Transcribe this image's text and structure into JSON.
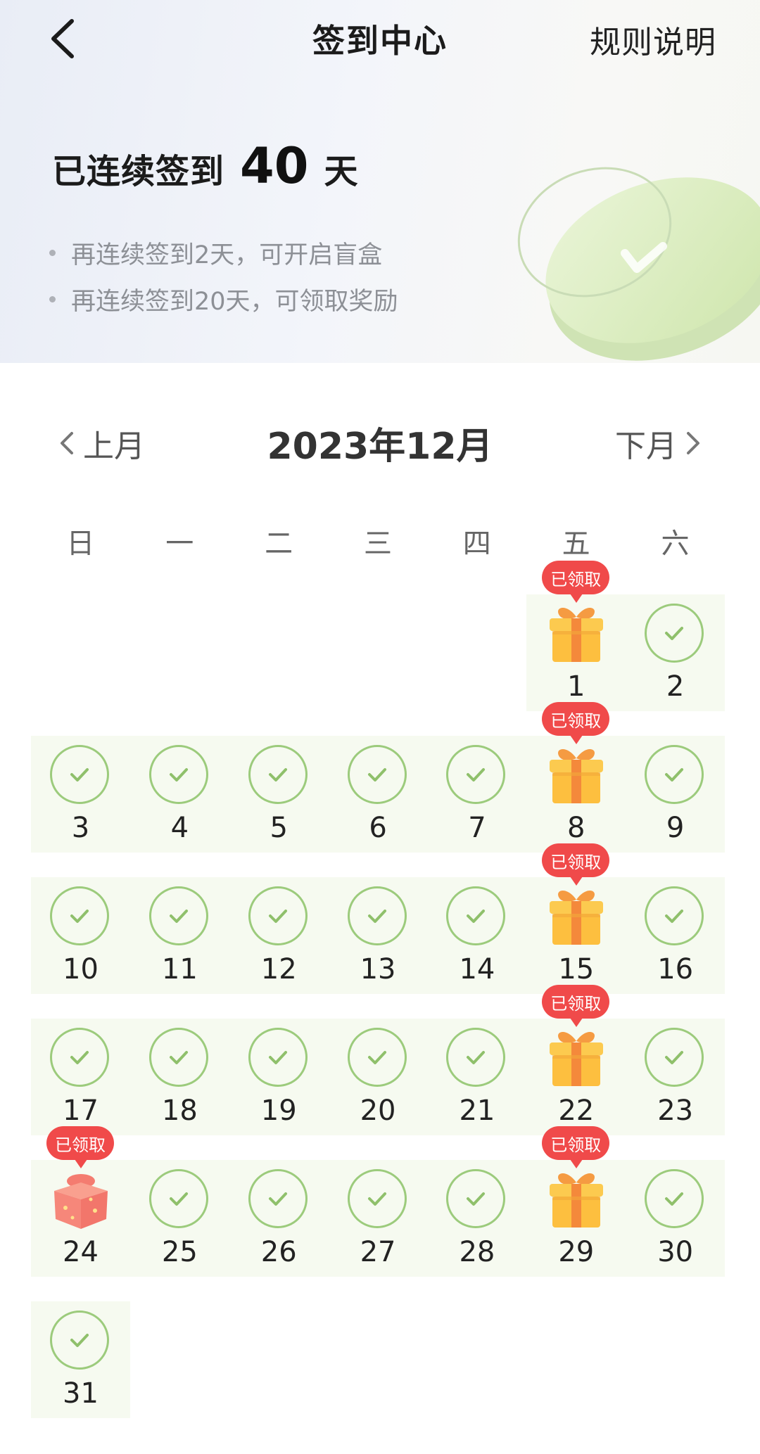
{
  "header": {
    "back_icon": "chevron-left-icon",
    "title": "签到中心",
    "rules_link": "规则说明",
    "streak_prefix": "已连续签到",
    "streak_days": "40",
    "streak_unit": "天",
    "tips": [
      "再连续签到2天，可开启盲盒",
      "再连续签到20天，可领取奖励"
    ]
  },
  "calendar": {
    "prev_label": "上月",
    "next_label": "下月",
    "month_title": "2023年12月",
    "weekdays": [
      "日",
      "一",
      "二",
      "三",
      "四",
      "五",
      "六"
    ],
    "claimed_label": "已领取",
    "colors": {
      "check_green": "#9ccb7c",
      "cell_bg": "#f6faf0",
      "tag_red": "#f04a4a"
    },
    "days": [
      {
        "day": "1",
        "status": "gift-claimed"
      },
      {
        "day": "2",
        "status": "checked"
      },
      {
        "day": "3",
        "status": "checked"
      },
      {
        "day": "4",
        "status": "checked"
      },
      {
        "day": "5",
        "status": "checked"
      },
      {
        "day": "6",
        "status": "checked"
      },
      {
        "day": "7",
        "status": "checked"
      },
      {
        "day": "8",
        "status": "gift-claimed"
      },
      {
        "day": "9",
        "status": "checked"
      },
      {
        "day": "10",
        "status": "checked"
      },
      {
        "day": "11",
        "status": "checked"
      },
      {
        "day": "12",
        "status": "checked"
      },
      {
        "day": "13",
        "status": "checked"
      },
      {
        "day": "14",
        "status": "checked"
      },
      {
        "day": "15",
        "status": "gift-claimed"
      },
      {
        "day": "16",
        "status": "checked"
      },
      {
        "day": "17",
        "status": "checked"
      },
      {
        "day": "18",
        "status": "checked"
      },
      {
        "day": "19",
        "status": "checked"
      },
      {
        "day": "20",
        "status": "checked"
      },
      {
        "day": "21",
        "status": "checked"
      },
      {
        "day": "22",
        "status": "gift-claimed"
      },
      {
        "day": "23",
        "status": "checked"
      },
      {
        "day": "24",
        "status": "blindbox-claimed"
      },
      {
        "day": "25",
        "status": "checked"
      },
      {
        "day": "26",
        "status": "checked"
      },
      {
        "day": "27",
        "status": "checked"
      },
      {
        "day": "28",
        "status": "checked"
      },
      {
        "day": "29",
        "status": "gift-claimed"
      },
      {
        "day": "30",
        "status": "checked"
      },
      {
        "day": "31",
        "status": "checked"
      }
    ]
  }
}
